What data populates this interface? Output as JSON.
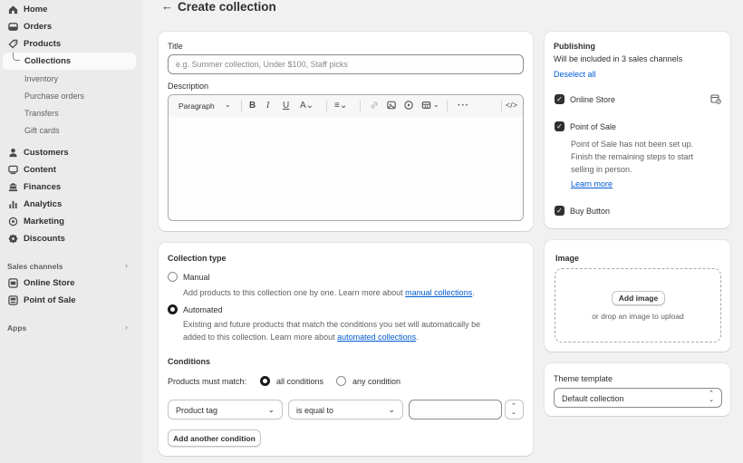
{
  "sidebar": {
    "items": [
      {
        "label": "Home",
        "icon": "home-icon"
      },
      {
        "label": "Orders",
        "icon": "orders-icon"
      },
      {
        "label": "Products",
        "icon": "tag-icon"
      },
      {
        "label": "Collections"
      },
      {
        "label": "Inventory"
      },
      {
        "label": "Purchase orders"
      },
      {
        "label": "Transfers"
      },
      {
        "label": "Gift cards"
      },
      {
        "label": "Customers",
        "icon": "person-icon"
      },
      {
        "label": "Content",
        "icon": "content-icon"
      },
      {
        "label": "Finances",
        "icon": "bank-icon"
      },
      {
        "label": "Analytics",
        "icon": "chart-icon"
      },
      {
        "label": "Marketing",
        "icon": "target-icon"
      },
      {
        "label": "Discounts",
        "icon": "discount-icon"
      }
    ],
    "sales_channels_label": "Sales channels",
    "channels": [
      {
        "label": "Online Store",
        "icon": "store-icon"
      },
      {
        "label": "Point of Sale",
        "icon": "pos-icon"
      }
    ],
    "apps_label": "Apps"
  },
  "header": {
    "back": "←",
    "title": "Create collection"
  },
  "form": {
    "title_label": "Title",
    "title_placeholder": "e.g. Summer collection, Under $100, Staff picks",
    "description_label": "Description",
    "paragraph_label": "Paragraph"
  },
  "collection_type": {
    "heading": "Collection type",
    "manual_label": "Manual",
    "manual_desc": "Add products to this collection one by one. Learn more about ",
    "manual_link": "manual collections",
    "automated_label": "Automated",
    "automated_desc_1": "Existing and future products that match the conditions you set will automatically be",
    "automated_desc_2": "added to this collection. Learn more about ",
    "automated_link": "automated collections",
    "selected": "Automated"
  },
  "conditions": {
    "heading": "Conditions",
    "match_label": "Products must match:",
    "all_label": "all conditions",
    "any_label": "any condition",
    "field": "Product tag",
    "operator": "is equal to",
    "value": "",
    "add_button": "Add another condition"
  },
  "publishing": {
    "heading": "Publishing",
    "subtitle": "Will be included in 3 sales channels",
    "deselect": "Deselect all",
    "online_store": "Online Store",
    "pos": "Point of Sale",
    "pos_note_1": "Point of Sale has not been set up.",
    "pos_note_2": "Finish the remaining steps to start",
    "pos_note_3": "selling in person.",
    "learn_more": "Learn more",
    "buy_button": "Buy Button"
  },
  "image": {
    "heading": "Image",
    "add_button": "Add image",
    "drop_text": "or drop an image to upload"
  },
  "theme": {
    "heading": "Theme template",
    "value": "Default collection"
  }
}
